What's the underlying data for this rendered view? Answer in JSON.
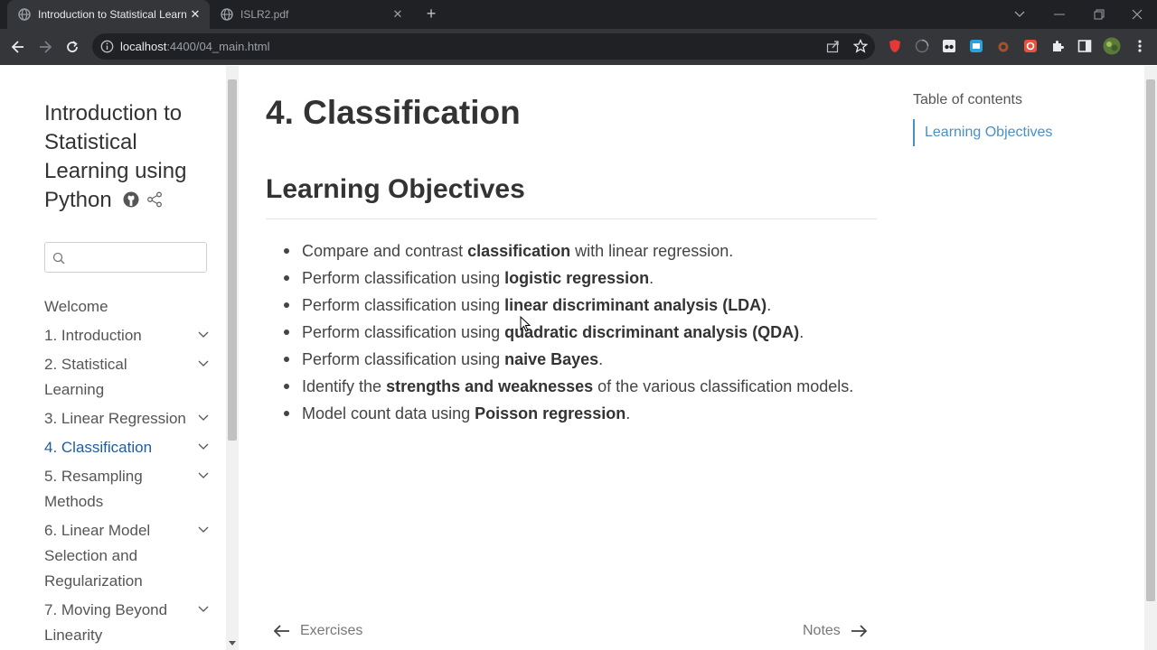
{
  "browser": {
    "tabs": [
      {
        "title": "Introduction to Statistical Learning",
        "active": true
      },
      {
        "title": "ISLR2.pdf",
        "active": false
      }
    ],
    "url_host": "localhost",
    "url_path": ":4400/04_main.html"
  },
  "sidebar": {
    "site_title": "Introduction to Statistical Learning using Python",
    "search_placeholder": "",
    "nav": [
      {
        "label": "Welcome",
        "expandable": false
      },
      {
        "label": "1. Introduction",
        "expandable": true
      },
      {
        "label": "2. Statistical Learning",
        "expandable": true
      },
      {
        "label": "3. Linear Regression",
        "expandable": true
      },
      {
        "label": "4. Classification",
        "expandable": true,
        "active": true
      },
      {
        "label": "5. Resampling Methods",
        "expandable": true
      },
      {
        "label": "6. Linear Model Selection and Regularization",
        "expandable": true
      },
      {
        "label": "7. Moving Beyond Linearity",
        "expandable": true
      }
    ]
  },
  "main": {
    "title": "4. Classification",
    "section_title": "Learning Objectives",
    "objectives": [
      {
        "pre": "Compare and contrast ",
        "bold": "classification",
        "post": " with linear regression."
      },
      {
        "pre": "Perform classification using ",
        "bold": "logistic regression",
        "post": "."
      },
      {
        "pre": "Perform classification using ",
        "bold": "linear discriminant analysis (LDA)",
        "post": "."
      },
      {
        "pre": "Perform classification using ",
        "bold": "quadratic discriminant analysis (QDA)",
        "post": "."
      },
      {
        "pre": "Perform classification using ",
        "bold": "naive Bayes",
        "post": "."
      },
      {
        "pre": "Identify the ",
        "bold": "strengths and weaknesses",
        "post": " of the various classification models."
      },
      {
        "pre": "Model count data using ",
        "bold": "Poisson regression",
        "post": "."
      }
    ],
    "pager_prev": "Exercises",
    "pager_next": "Notes"
  },
  "toc": {
    "heading": "Table of contents",
    "items": [
      "Learning Objectives"
    ]
  },
  "colors": {
    "accent": "#1f5b9e",
    "toc_accent": "#4a90c2",
    "chrome_dark": "#202124",
    "chrome_toolbar": "#35363a"
  }
}
